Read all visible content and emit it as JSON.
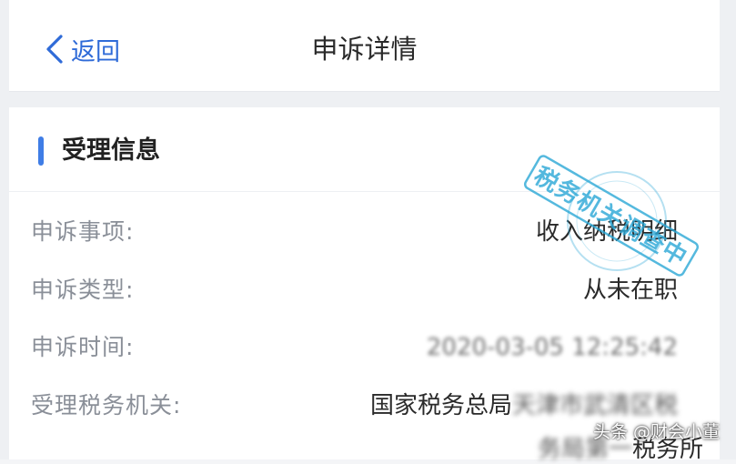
{
  "header": {
    "back_label": "返回",
    "title": "申诉详情"
  },
  "section": {
    "title": "受理信息"
  },
  "rows": [
    {
      "label": "申诉事项:",
      "value": "收入纳税明细"
    },
    {
      "label": "申诉类型:",
      "value": "从未在职"
    },
    {
      "label": "申诉时间:",
      "value": "2020-03-05 12:25:42"
    },
    {
      "label": "受理税务机关:",
      "value": "国家税务总局",
      "value_hidden": "天津市武清区税",
      "value_line2_hidden": "务局第一",
      "value_line2": "税务所"
    }
  ],
  "stamp": {
    "text": "税务机关调查中",
    "color": "#2aa7d6"
  },
  "watermark": "头条 @财会小董",
  "colors": {
    "accent": "#2f6bd8",
    "section_bar": "#3f7de6"
  }
}
